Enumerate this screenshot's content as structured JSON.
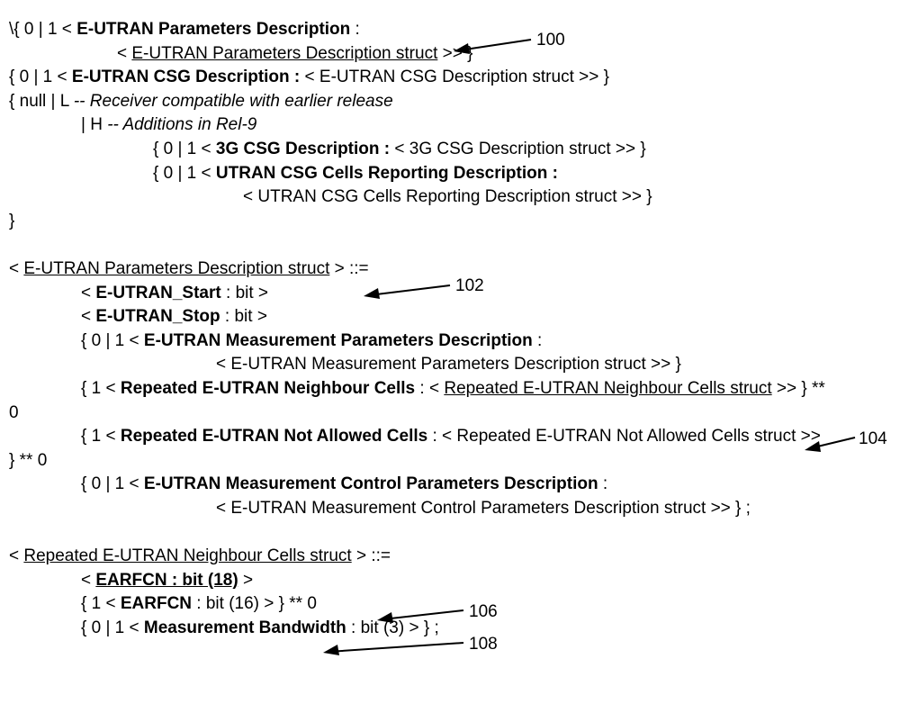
{
  "l1a": "\\{ 0 | 1    < ",
  "l1b": "E-UTRAN Parameters Description",
  "l1c": " :",
  "l2a": "< ",
  "l2b": "E-UTRAN Parameters Description struct",
  "l2c": " >> }",
  "l3a": "{ 0 | 1    < ",
  "l3b": "E-UTRAN CSG Description :",
  "l3c": " < E-UTRAN CSG Description struct >> }",
  "l4a": "{          null | L   ",
  "l4b": "-- Receiver compatible with earlier release",
  "l5a": "| H                               ",
  "l5b": "-- Additions in Rel-9",
  "l6a": "{ 0 | 1    < ",
  "l6b": "3G CSG Description :",
  "l6c": " < 3G CSG Description struct >> }",
  "l7a": "{ 0 | 1    < ",
  "l7b": "UTRAN CSG Cells Reporting Description :",
  "l8a": "< UTRAN CSG Cells Reporting Description struct >> }",
  "l9a": "}",
  "l10a": "< ",
  "l10b": "E-UTRAN Parameters Description struct",
  "l10c": " > ::=",
  "l11a": "< ",
  "l11b": "E-UTRAN_Start",
  "l11c": " : bit >",
  "l12a": "< ",
  "l12b": "E-UTRAN_Stop",
  "l12c": " : bit >",
  "l13a": "{ 0 | 1    < ",
  "l13b": "E-UTRAN Measurement Parameters Description",
  "l13c": " :",
  "l14a": "< E-UTRAN Measurement Parameters Description struct >> }",
  "l15a": "{ 1 < ",
  "l15b": "Repeated E-UTRAN Neighbour Cells",
  "l15c": " : < ",
  "l15d": "Repeated E-UTRAN Neighbour Cells struct",
  "l15e": " >> } **",
  "l16a": "0",
  "l17a": "{ 1 < ",
  "l17b": "Repeated E-UTRAN Not Allowed Cells",
  "l17c": " : < Repeated E-UTRAN Not Allowed Cells struct >>",
  "l18a": "} ** 0",
  "l19a": "{ 0 | 1    < ",
  "l19b": "E-UTRAN Measurement Control Parameters Description",
  "l19c": " :",
  "l20a": "< E-UTRAN Measurement Control Parameters Description struct >> } ;",
  "l21a": "< ",
  "l21b": "Repeated E-UTRAN Neighbour Cells struct",
  "l21c": " > ::=",
  "l22a": "< ",
  "l22b": "EARFCN : bit (18)",
  "l22c": " >",
  "l23a": "{ 1 < ",
  "l23b": "EARFCN",
  "l23c": " : bit (16) > } ** 0",
  "l24a": "{ 0 | 1 < ",
  "l24b": "Measurement Bandwidth",
  "l24c": " : bit (3) > } ;",
  "callout100": "100",
  "callout102": "102",
  "callout104": "104",
  "callout106": "106",
  "callout108": "108"
}
